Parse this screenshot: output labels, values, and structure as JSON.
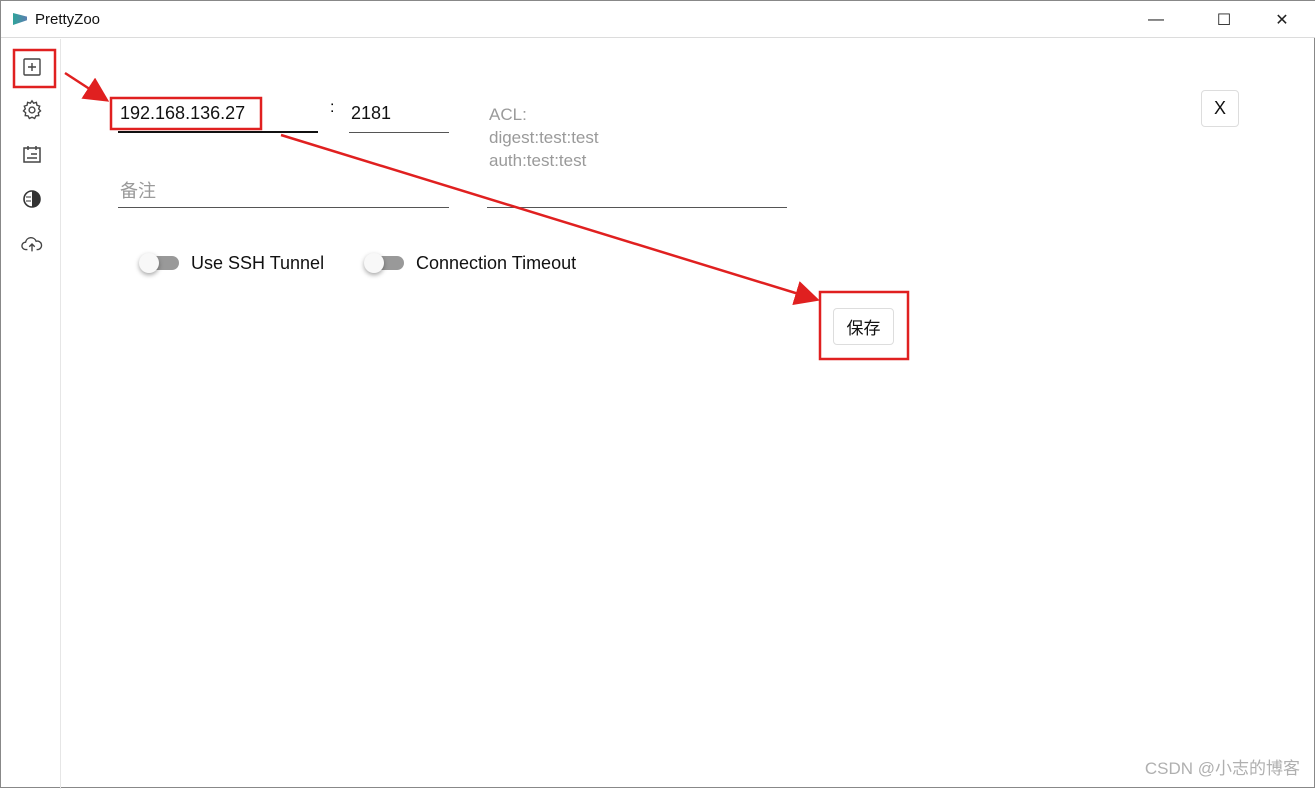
{
  "window": {
    "title": "PrettyZoo",
    "minimize": "—",
    "maximize": "☐",
    "close": "✕"
  },
  "sidebar": {
    "items": [
      {
        "name": "add-server",
        "icon": "plus-square-icon"
      },
      {
        "name": "settings",
        "icon": "gear-icon"
      },
      {
        "name": "log",
        "icon": "calendar-icon"
      },
      {
        "name": "theme",
        "icon": "contrast-icon"
      },
      {
        "name": "upload",
        "icon": "cloud-upload-icon"
      }
    ]
  },
  "form": {
    "host": "192.168.136.27",
    "colon": ":",
    "port": "2181",
    "acl_placeholder": [
      "ACL:",
      "digest:test:test",
      "auth:test:test"
    ],
    "remark_placeholder": "备注",
    "ssh_tunnel_label": "Use SSH Tunnel",
    "ssh_tunnel_on": false,
    "timeout_label": "Connection Timeout",
    "timeout_on": false,
    "save_label": "保存",
    "close_label": "X"
  },
  "annotation_color": "#e02020",
  "watermark": "CSDN @小志的博客"
}
